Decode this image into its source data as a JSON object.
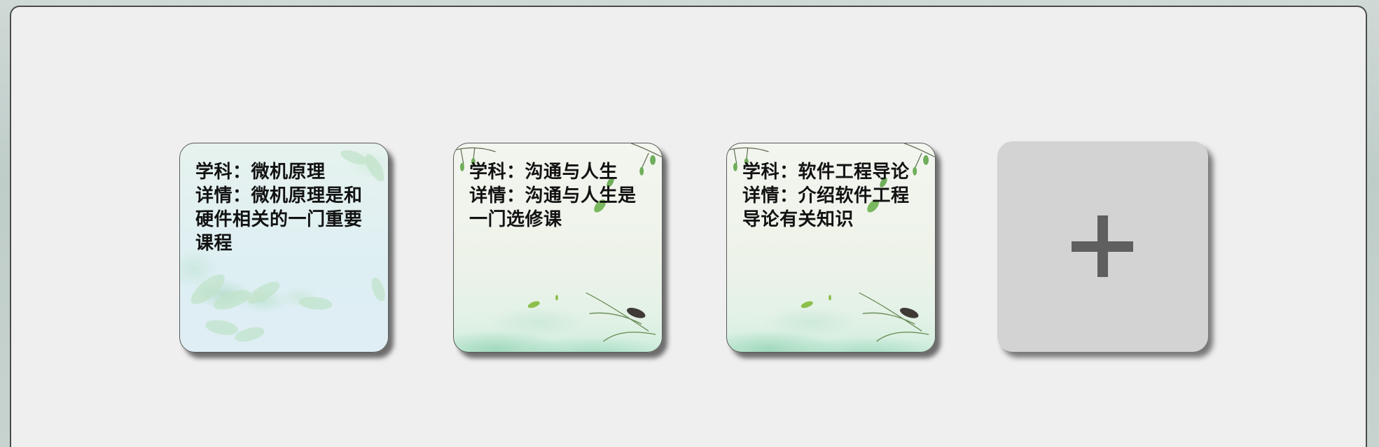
{
  "courses": [
    {
      "subject_line": "学科：微机原理",
      "detail_line": "详情：微机原理是和硬件相关的一门重要课程"
    },
    {
      "subject_line": "学科：沟通与人生",
      "detail_line": "详情：沟通与人生是一门选修课"
    },
    {
      "subject_line": "学科：软件工程导论",
      "detail_line": "详情：介绍软件工程导论有关知识"
    }
  ],
  "add_button": {
    "icon": "plus-icon"
  },
  "colors": {
    "panel_background": "#efefef",
    "add_card_background": "#d3d3d3",
    "plus_color": "#5f5f5f",
    "text_color": "#121212"
  }
}
